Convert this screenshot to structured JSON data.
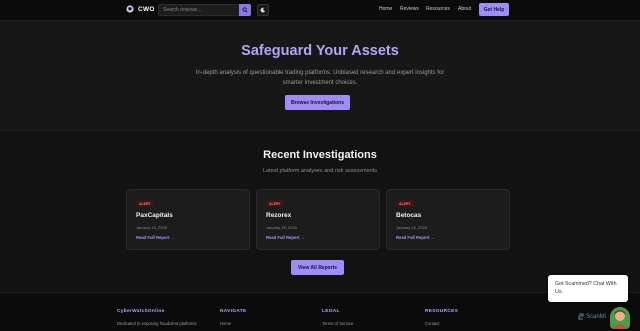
{
  "brand": {
    "name": "CWO"
  },
  "search": {
    "placeholder": "Search reviews..."
  },
  "nav": {
    "links": [
      "Home",
      "Reviews",
      "Resources",
      "About"
    ],
    "cta": "Get Help"
  },
  "hero": {
    "title": "Safeguard Your Assets",
    "subtitle": "In-depth analysis of questionable trading platforms. Unbiased research and expert insights for smarter investment choices.",
    "button": "Browse Investigations"
  },
  "investigations": {
    "title": "Recent Investigations",
    "subtitle": "Latest platform analyses and risk assessments",
    "cards": [
      {
        "badge": "ALERT",
        "name": "PaxCapitals",
        "date": "January 15, 2026",
        "link": "Read Full Report →"
      },
      {
        "badge": "ALERT",
        "name": "Rezorex",
        "date": "January 15, 2026",
        "link": "Read Full Report →"
      },
      {
        "badge": "ALERT",
        "name": "Betocas",
        "date": "January 15, 2026",
        "link": "Read Full Report →"
      }
    ],
    "view_all": "View All Reports"
  },
  "footer": {
    "about": {
      "heading": "CyberWatchOnline",
      "text": "Dedicated to exposing fraudulent platforms"
    },
    "navigate": {
      "heading": "NAVIGATE",
      "item": "Home"
    },
    "legal": {
      "heading": "LEGAL",
      "item": "Terms of Service"
    },
    "resources": {
      "heading": "RESOURCES",
      "item": "Contact"
    }
  },
  "chat": {
    "text": "Got Scammed? Chat With Us."
  },
  "watermark": {
    "text": "ScanMi"
  },
  "colors": {
    "accent": "#9f8cf5",
    "title": "#b5a5f8",
    "alert_bg": "#3d1515",
    "alert_fg": "#f07a7a"
  }
}
